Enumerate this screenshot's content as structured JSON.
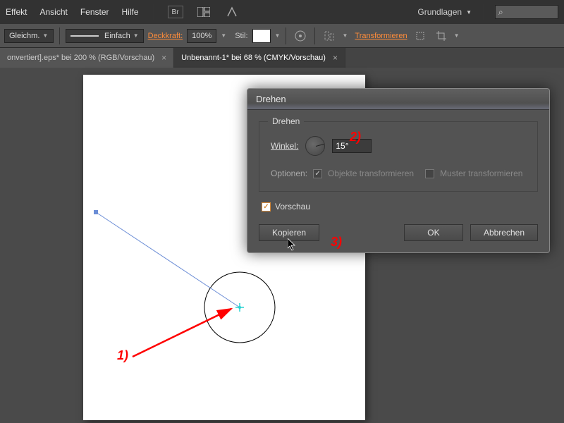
{
  "menubar": {
    "items": [
      "Effekt",
      "Ansicht",
      "Fenster",
      "Hilfe"
    ],
    "workspace": "Grundlagen"
  },
  "optionsbar": {
    "align_mode": "Gleichm.",
    "stroke_profile": "Einfach",
    "opacity_label": "Deckkraft:",
    "opacity_value": "100%",
    "style_label": "Stil:",
    "transform_label": "Transformieren"
  },
  "tabs": [
    {
      "label": "onvertiert].eps* bei 200 % (RGB/Vorschau)",
      "active": false
    },
    {
      "label": "Unbenannt-1* bei 68 % (CMYK/Vorschau)",
      "active": true
    }
  ],
  "dialog": {
    "title": "Drehen",
    "group_label": "Drehen",
    "angle_label": "Winkel:",
    "angle_value": "15°",
    "options_label": "Optionen:",
    "opt_objects": "Objekte transformieren",
    "opt_patterns": "Muster transformieren",
    "preview_label": "Vorschau",
    "btn_copy": "Kopieren",
    "btn_ok": "OK",
    "btn_cancel": "Abbrechen"
  },
  "annotations": {
    "a1": "1)",
    "a2": "2)",
    "a3": "3)"
  }
}
